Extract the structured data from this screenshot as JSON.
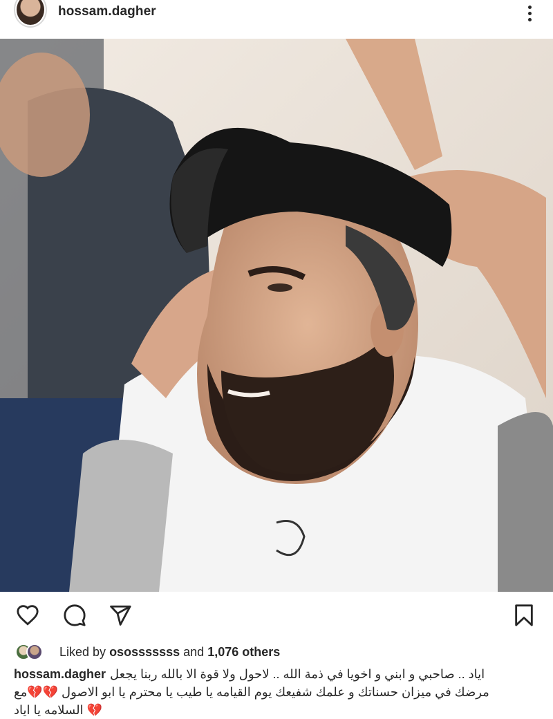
{
  "post": {
    "username": "hossam.dagher",
    "more_icon": "more-vertical-icon"
  },
  "actions": {
    "like_icon": "heart-icon",
    "comment_icon": "comment-icon",
    "share_icon": "send-icon",
    "save_icon": "bookmark-icon"
  },
  "likes": {
    "prefix": "Liked by",
    "user": "ososssssss",
    "middle": "and",
    "count": "1,076 others"
  },
  "caption": {
    "username": "hossam.dagher",
    "line1": "اياد .. صاحبي و ابني و اخويا في ذمة الله .. لاحول ولا قوة الا بالله ربنا يجعل",
    "line2": "مرضك في ميزان حسناتك و علمك شفيعك يوم القيامه يا طيب يا محترم يا ابو الاصول 💔💔مع",
    "line3": "💔 السلامه يا اياد"
  },
  "colors": {
    "text": "#262626",
    "broken_heart": "#e0245e"
  }
}
